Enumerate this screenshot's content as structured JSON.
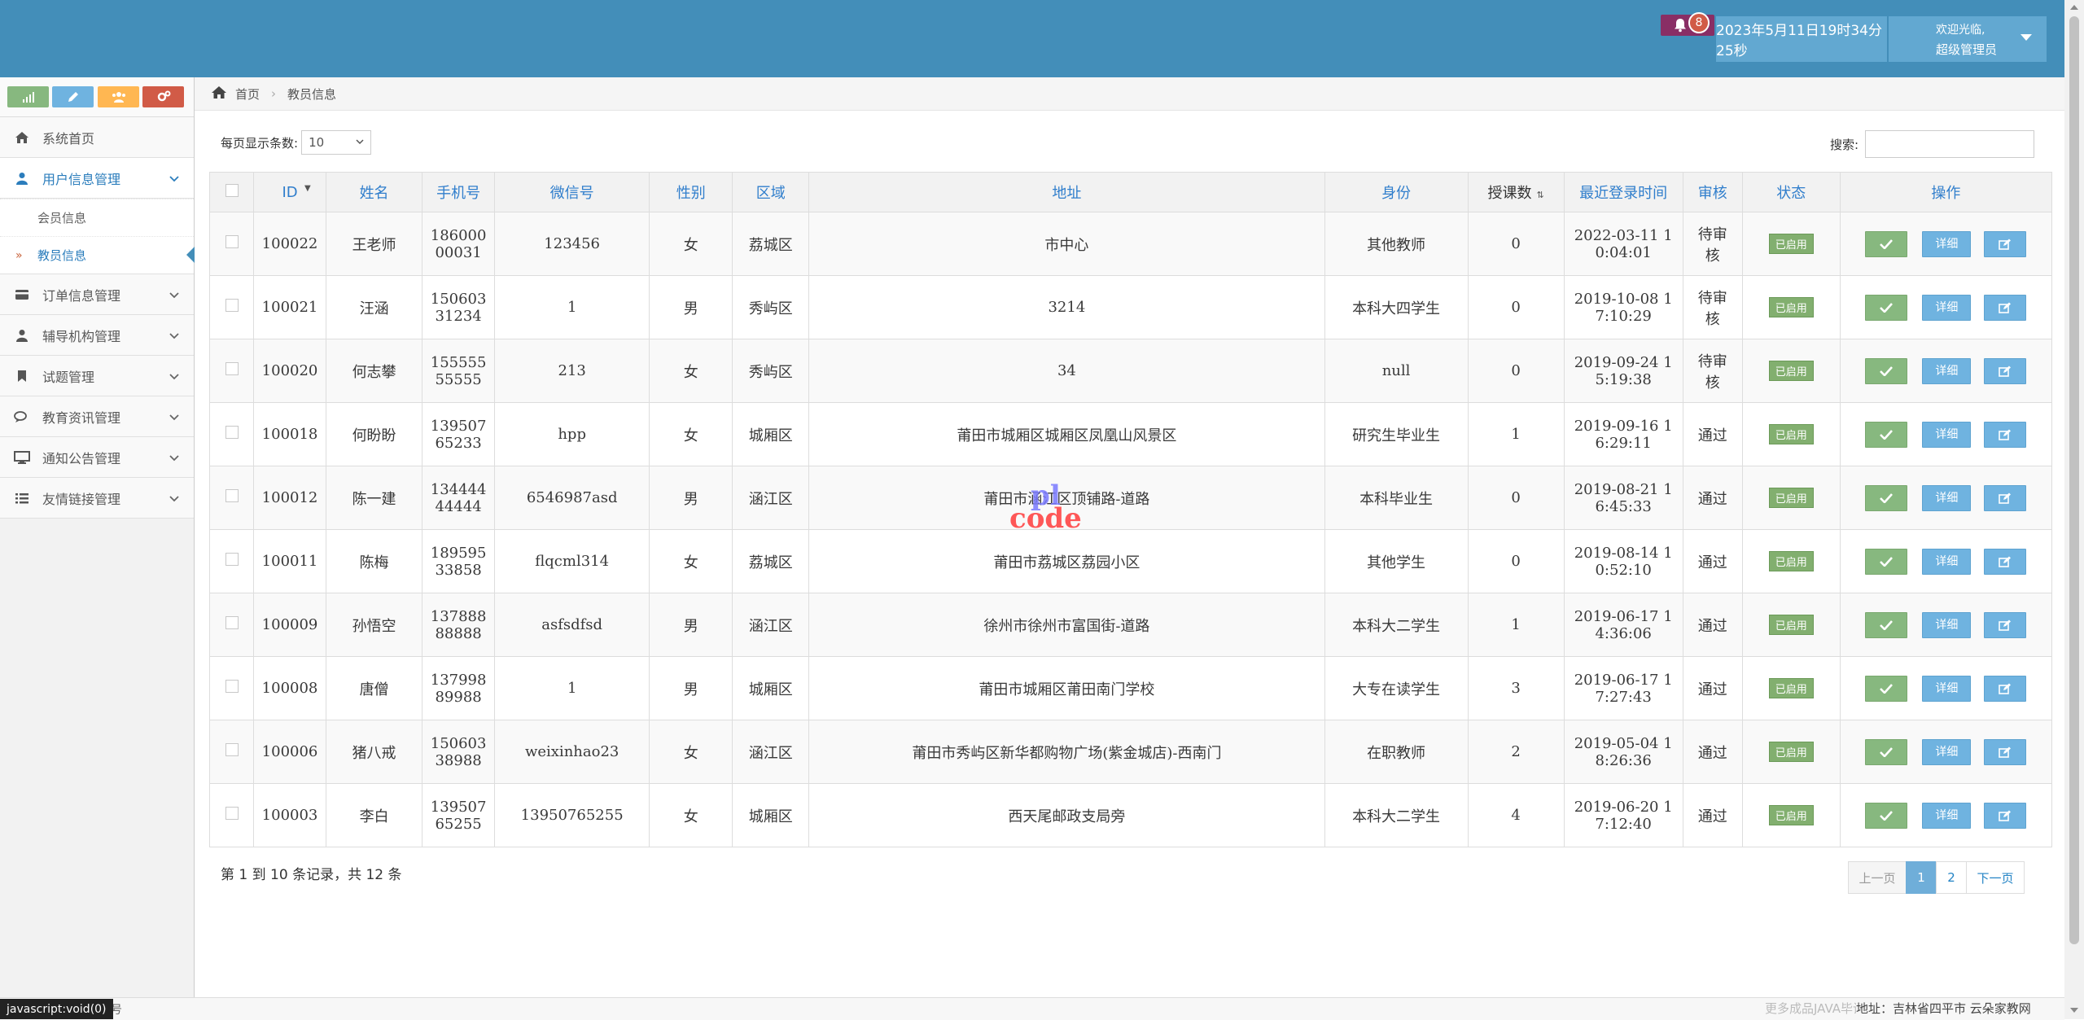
{
  "header": {
    "notification_count": "8",
    "datetime": "2023年5月11日19时34分25秒",
    "welcome": "欢迎光临,",
    "role": "超级管理员"
  },
  "sidebar": {
    "items": [
      {
        "label": "系统首页",
        "icon": "home-icon"
      },
      {
        "label": "用户信息管理",
        "icon": "user-icon",
        "open": true,
        "children": [
          {
            "label": "会员信息"
          },
          {
            "label": "教员信息",
            "active": true
          }
        ]
      },
      {
        "label": "订单信息管理",
        "icon": "credit-card-icon"
      },
      {
        "label": "辅导机构管理",
        "icon": "user-icon"
      },
      {
        "label": "试题管理",
        "icon": "bookmark-icon"
      },
      {
        "label": "教育资讯管理",
        "icon": "comments-icon"
      },
      {
        "label": "通知公告管理",
        "icon": "desktop-icon"
      },
      {
        "label": "友情链接管理",
        "icon": "list-icon"
      }
    ]
  },
  "breadcrumb": {
    "home": "首页",
    "current": "教员信息"
  },
  "controls": {
    "page_size_label": "每页显示条数:",
    "page_size": "10",
    "search_label": "搜索:"
  },
  "table": {
    "headers": [
      "ID",
      "姓名",
      "手机号",
      "微信号",
      "性别",
      "区域",
      "地址",
      "身份",
      "授课数",
      "最近登录时间",
      "审核",
      "状态",
      "操作"
    ],
    "status_label": "已启用",
    "detail_label": "详细",
    "rows": [
      {
        "id": "100022",
        "name": "王老师",
        "phone": [
          "186000",
          "00031"
        ],
        "wechat": "123456",
        "gender": "女",
        "area": "荔城区",
        "address": "市中心",
        "identity": "其他教师",
        "lessons": "0",
        "login": [
          "2022-03-11 1",
          "0:04:01"
        ],
        "review": [
          "待审",
          "核"
        ],
        "pending": true
      },
      {
        "id": "100021",
        "name": "汪涵",
        "phone": [
          "150603",
          "31234"
        ],
        "wechat": "1",
        "gender": "男",
        "area": "秀屿区",
        "address": "3214",
        "identity": "本科大四学生",
        "lessons": "0",
        "login": [
          "2019-10-08 1",
          "7:10:29"
        ],
        "review": [
          "待审",
          "核"
        ],
        "pending": true
      },
      {
        "id": "100020",
        "name": "何志攀",
        "phone": [
          "155555",
          "55555"
        ],
        "wechat": "213",
        "gender": "女",
        "area": "秀屿区",
        "address": "34",
        "identity": "null",
        "lessons": "0",
        "login": [
          "2019-09-24 1",
          "5:19:38"
        ],
        "review": [
          "待审",
          "核"
        ],
        "pending": true
      },
      {
        "id": "100018",
        "name": "何盼盼",
        "phone": [
          "139507",
          "65233"
        ],
        "wechat": "hpp",
        "gender": "女",
        "area": "城厢区",
        "address": "莆田市城厢区城厢区凤凰山风景区",
        "identity": "研究生毕业生",
        "lessons": "1",
        "login": [
          "2019-09-16 1",
          "6:29:11"
        ],
        "review": [
          "通过"
        ],
        "pending": false
      },
      {
        "id": "100012",
        "name": "陈一建",
        "phone": [
          "134444",
          "44444"
        ],
        "wechat": "6546987asd",
        "gender": "男",
        "area": "涵江区",
        "address": "莆田市涵江区顶铺路-道路",
        "identity": "本科毕业生",
        "lessons": "0",
        "login": [
          "2019-08-21 1",
          "6:45:33"
        ],
        "review": [
          "通过"
        ],
        "pending": false
      },
      {
        "id": "100011",
        "name": "陈梅",
        "phone": [
          "189595",
          "33858"
        ],
        "wechat": "flqcml314",
        "gender": "女",
        "area": "荔城区",
        "address": "莆田市荔城区荔园小区",
        "identity": "其他学生",
        "lessons": "0",
        "login": [
          "2019-08-14 1",
          "0:52:10"
        ],
        "review": [
          "通过"
        ],
        "pending": false
      },
      {
        "id": "100009",
        "name": "孙悟空",
        "phone": [
          "137888",
          "88888"
        ],
        "wechat": "asfsdfsd",
        "gender": "男",
        "area": "涵江区",
        "address": "徐州市徐州市富国街-道路",
        "identity": "本科大二学生",
        "lessons": "1",
        "login": [
          "2019-06-17 1",
          "4:36:06"
        ],
        "review": [
          "通过"
        ],
        "pending": false
      },
      {
        "id": "100008",
        "name": "唐僧",
        "phone": [
          "137998",
          "89988"
        ],
        "wechat": "1",
        "gender": "男",
        "area": "城厢区",
        "address": "莆田市城厢区莆田南门学校",
        "identity": "大专在读学生",
        "lessons": "3",
        "login": [
          "2019-06-17 1",
          "7:27:43"
        ],
        "review": [
          "通过"
        ],
        "pending": false
      },
      {
        "id": "100006",
        "name": "猪八戒",
        "phone": [
          "150603",
          "38988"
        ],
        "wechat": "weixinhao23",
        "gender": "女",
        "area": "涵江区",
        "address": "莆田市秀屿区新华都购物广场(紫金城店)-西南门",
        "identity": "在职教师",
        "lessons": "2",
        "login": [
          "2019-05-04 1",
          "8:26:36"
        ],
        "review": [
          "通过"
        ],
        "pending": false
      },
      {
        "id": "100003",
        "name": "李白",
        "phone": [
          "139507",
          "65255"
        ],
        "wechat": "13950765255",
        "gender": "女",
        "area": "城厢区",
        "address": "西天尾邮政支局旁",
        "identity": "本科大二学生",
        "lessons": "4",
        "login": [
          "2019-06-20 1",
          "7:12:40"
        ],
        "review": [
          "通过"
        ],
        "pending": false
      }
    ]
  },
  "pagination": {
    "info": "第 1 到 10 条记录，共 12 条",
    "prev": "上一页",
    "pages": [
      "1",
      "2"
    ],
    "current": "1",
    "next": "下一页"
  },
  "watermark": {
    "line1": "pl",
    "line2": "code"
  },
  "footer": {
    "js_status": "javascript:void(0)",
    "left_text": "号",
    "right_faded": "更多成品JAVA毕设项目",
    "right_address": "地址：吉林省四平市 云朵家教网"
  },
  "colors": {
    "topbar": "#438eb9",
    "accent": "#2b7dbc",
    "status_green": "#82af6f",
    "pending_red": "#d15b47",
    "detail_blue": "#6fb3e0"
  }
}
